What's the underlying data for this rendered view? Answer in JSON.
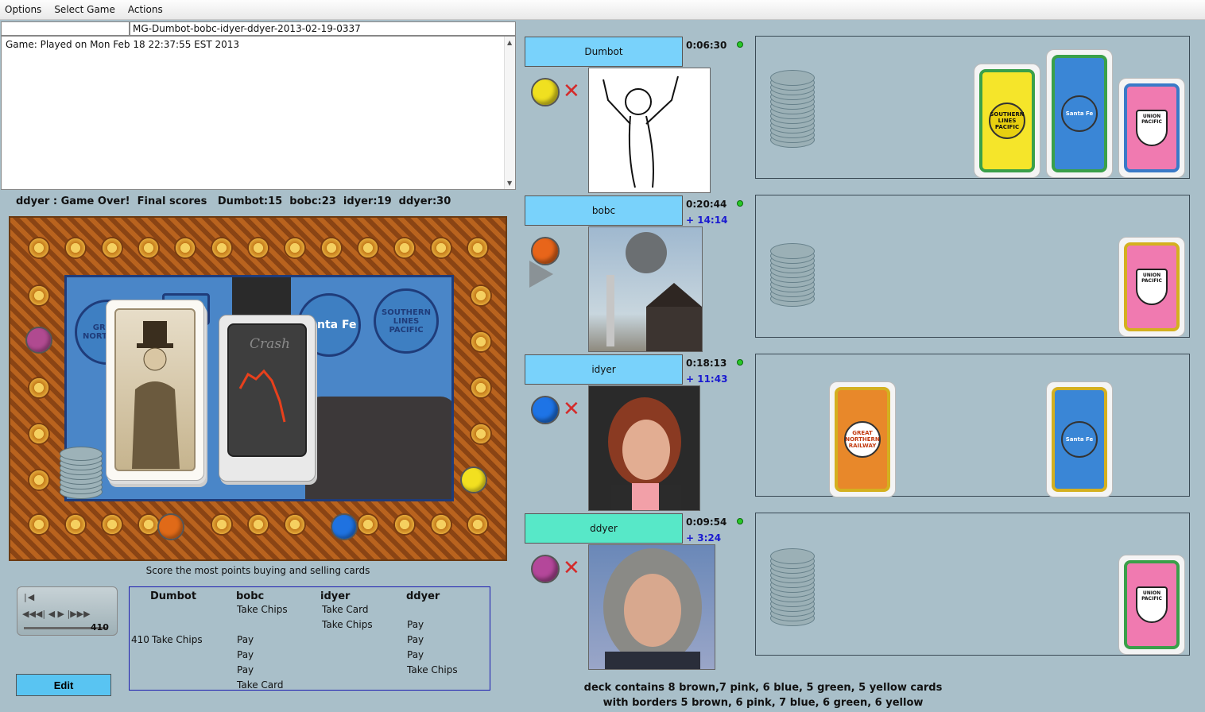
{
  "menu": [
    "Options",
    "Select Game",
    "Actions"
  ],
  "game_name": "MG-Dumbot-bobc-idyer-ddyer-2013-02-19-0337",
  "log_text": "Game: Played on Mon Feb 18 22:37:55 EST 2013",
  "status": "ddyer : Game Over!  Final scores   Dumbot:15  bobc:23  idyer:19  ddyer:30",
  "board": {
    "logos": [
      "GREAT NORTH RAI",
      "UNION",
      "Santa Fe",
      "SOUTHERN LINES PACIFIC"
    ],
    "crash_card": "Crash",
    "caption": "Score the most points buying and selling cards",
    "colors": {
      "magenta": "#b04a90",
      "orange": "#e06a18",
      "blue": "#1f72e0",
      "yellow": "#f2e020"
    }
  },
  "replay": {
    "position": "410"
  },
  "edit_label": "Edit",
  "moves": {
    "headers": [
      "Dumbot",
      "bobc",
      "idyer",
      "ddyer"
    ],
    "rows": [
      {
        "num": "",
        "c": [
          "",
          "Take Chips",
          "Take Card",
          ""
        ]
      },
      {
        "num": "",
        "c": [
          "",
          "",
          "Take Chips",
          "Pay"
        ]
      },
      {
        "num": "410",
        "c": [
          "Take Chips",
          "Pay",
          "",
          "Pay"
        ]
      },
      {
        "num": "",
        "c": [
          "",
          "Pay",
          "",
          "Pay"
        ]
      },
      {
        "num": "",
        "c": [
          "",
          "Pay",
          "",
          "Take Chips"
        ]
      },
      {
        "num": "",
        "c": [
          "",
          "Take Card",
          "",
          ""
        ]
      }
    ]
  },
  "players": [
    {
      "name": "Dumbot",
      "time": "0:06:30",
      "extra": "",
      "chip": "#f0e020"
    },
    {
      "name": "bobc",
      "time": "0:20:44",
      "extra": "+ 14:14",
      "chip": "#e8651a"
    },
    {
      "name": "idyer",
      "time": "0:18:13",
      "extra": "+ 11:43",
      "chip": "#1e74e6"
    },
    {
      "name": "ddyer",
      "time": "0:09:54",
      "extra": "+ 3:24",
      "chip": "#b4479a"
    }
  ],
  "card_labels": {
    "southern": "SOUTHERN LINES PACIFIC",
    "santafe": "Santa Fe",
    "union": "UNION PACIFIC",
    "greatnorthern": "GREAT NORTHERN RAILWAY"
  },
  "deck": {
    "line1": "deck contains 8 brown,7 pink, 6 blue, 5 green, 5 yellow cards",
    "line2": "with borders 5 brown, 6 pink, 7 blue, 6 green, 6 yellow"
  }
}
